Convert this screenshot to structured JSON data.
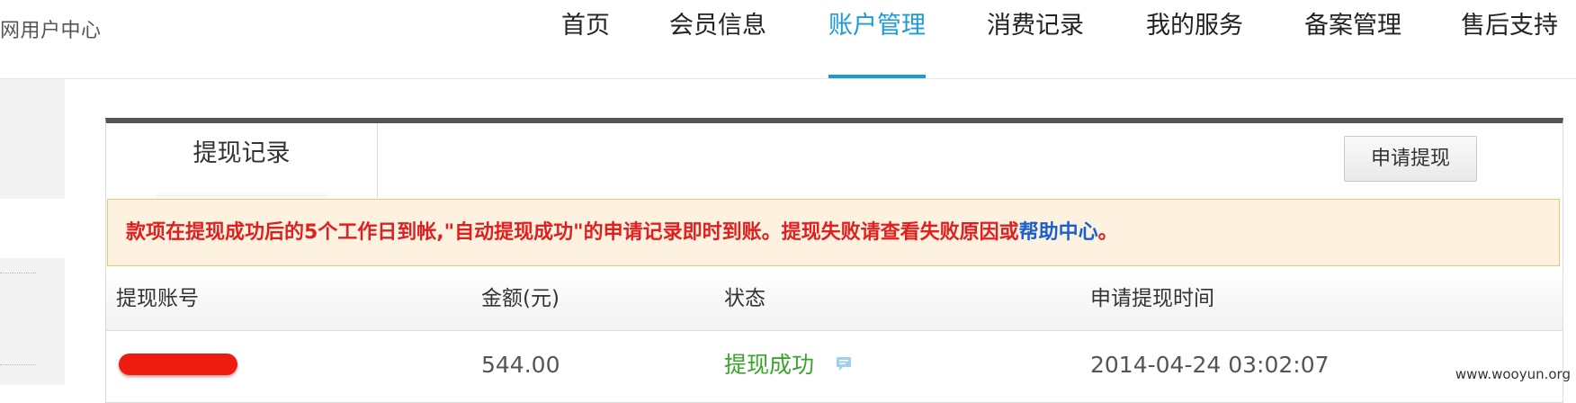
{
  "header": {
    "site_title": "网用户中心",
    "nav": [
      {
        "label": "首页",
        "active": false
      },
      {
        "label": "会员信息",
        "active": false
      },
      {
        "label": "账户管理",
        "active": true
      },
      {
        "label": "消费记录",
        "active": false
      },
      {
        "label": "我的服务",
        "active": false
      },
      {
        "label": "备案管理",
        "active": false
      },
      {
        "label": "售后支持",
        "active": false
      }
    ]
  },
  "panel": {
    "tab_label": "提现记录",
    "apply_button": "申请提现",
    "notice": {
      "text": "款项在提现成功后的5个工作日到帐,\"自动提现成功\"的申请记录即时到账。提现失败请查看失败原因或",
      "link": "帮助中心",
      "suffix": "。"
    },
    "table": {
      "columns": [
        "提现账号",
        "金额(元)",
        "状态",
        "申请提现时间"
      ],
      "rows": [
        {
          "account": "",
          "amount": "544.00",
          "status": "提现成功",
          "time": "2014-04-24 03:02:07"
        }
      ]
    }
  },
  "colors": {
    "accent": "#1e9bd7",
    "notice_text": "#e02020",
    "success": "#3aa52b",
    "link": "#1a5fcf"
  },
  "icons": {
    "status_detail": "message-icon"
  },
  "watermark": "www.wooyun.org"
}
